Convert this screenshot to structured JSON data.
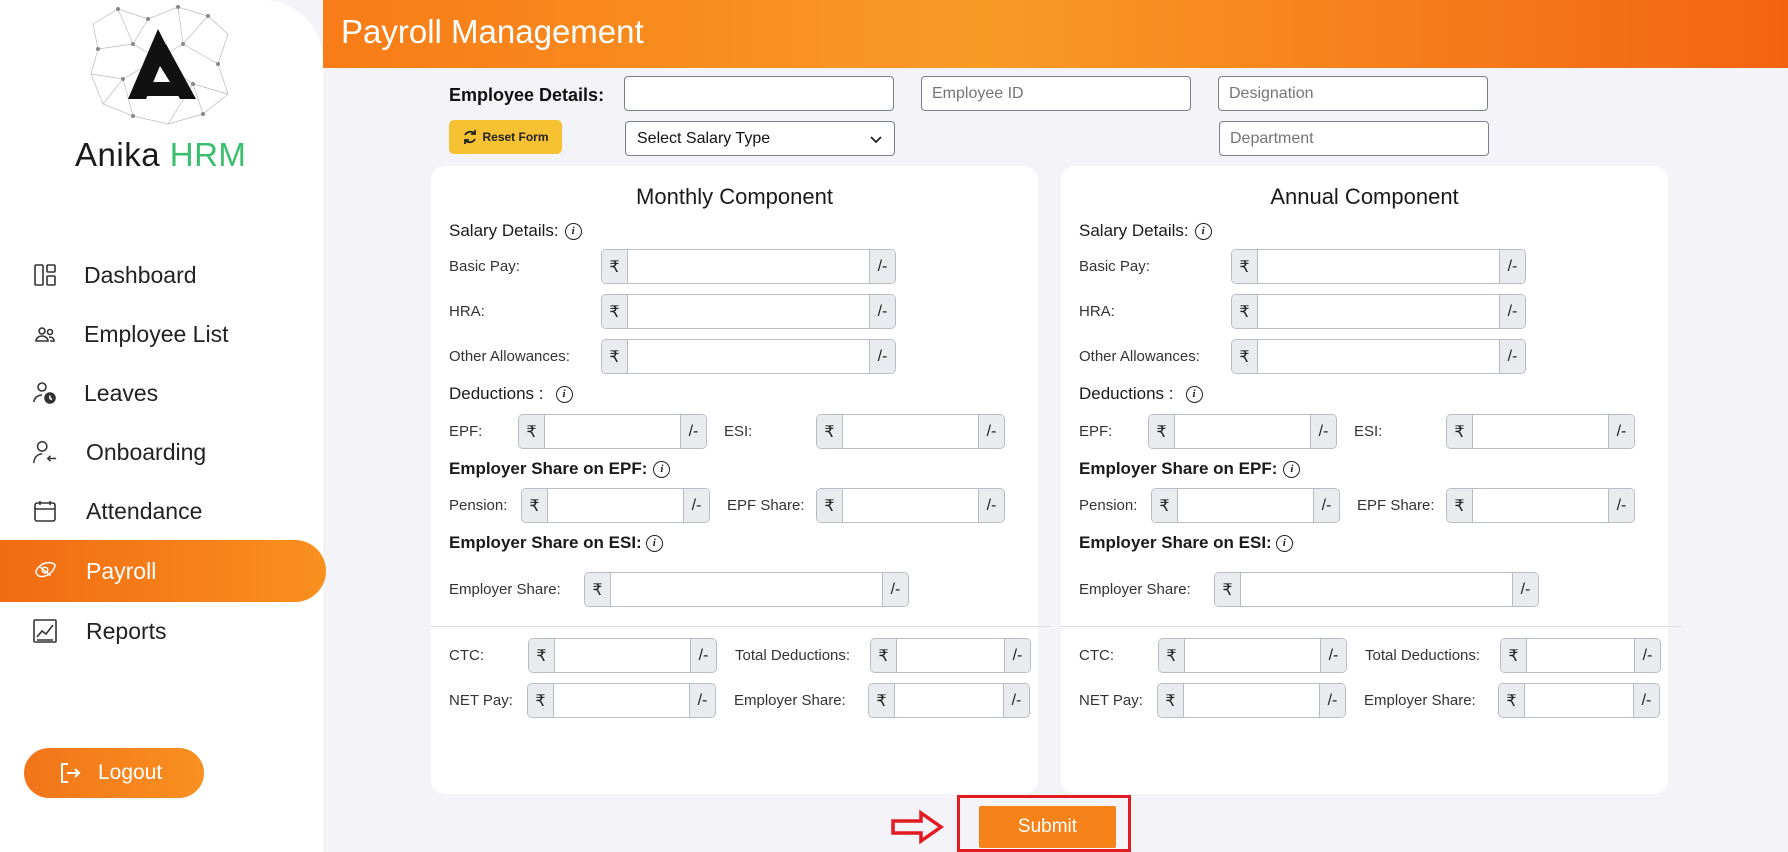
{
  "brand": {
    "name_main": "Anika",
    "name_accent": "HRM"
  },
  "sidebar": {
    "items": [
      {
        "label": "Dashboard",
        "icon": "dashboard-icon"
      },
      {
        "label": "Employee List",
        "icon": "users-icon"
      },
      {
        "label": "Leaves",
        "icon": "user-clock-icon"
      },
      {
        "label": "Onboarding",
        "icon": "user-arrow-icon"
      },
      {
        "label": "Attendance",
        "icon": "calendar-icon"
      },
      {
        "label": "Payroll",
        "icon": "money-icon",
        "active": true
      },
      {
        "label": "Reports",
        "icon": "chart-icon"
      }
    ],
    "logout_label": "Logout"
  },
  "header": {
    "title": "Payroll Management"
  },
  "employee": {
    "label": "Employee Details:",
    "name_value": "",
    "id_placeholder": "Employee ID",
    "designation_placeholder": "Designation",
    "department_placeholder": "Department",
    "salary_type": "Select Salary Type",
    "reset_label": "Reset Form"
  },
  "currency_prefix": "₹",
  "currency_suffix": "/-",
  "info_glyph": "i",
  "monthly": {
    "title": "Monthly Component",
    "salary_details": "Salary Details:",
    "basic_pay": "Basic Pay:",
    "hra": "HRA:",
    "other_allowances": "Other Allowances:",
    "deductions": "Deductions :",
    "epf": "EPF:",
    "esi": "ESI:",
    "employer_epf": "Employer Share on EPF:",
    "pension": "Pension:",
    "epf_share": "EPF Share:",
    "employer_esi": "Employer Share on ESI:",
    "employer_share": "Employer Share:",
    "ctc": "CTC:",
    "total_deductions": "Total Deductions:",
    "net_pay": "NET Pay:",
    "employer_share_total": "Employer Share:"
  },
  "annual": {
    "title": "Annual Component",
    "salary_details": "Salary Details:",
    "basic_pay": "Basic Pay:",
    "hra": "HRA:",
    "other_allowances": "Other Allowances:",
    "deductions": "Deductions :",
    "epf": "EPF:",
    "esi": "ESI:",
    "employer_epf": "Employer Share on EPF:",
    "pension": "Pension:",
    "epf_share": "EPF Share:",
    "employer_esi": "Employer Share on ESI:",
    "employer_share": "Employer Share:",
    "ctc": "CTC:",
    "total_deductions": "Total Deductions:",
    "net_pay": "NET Pay:",
    "employer_share_total": "Employer Share:"
  },
  "submit_label": "Submit",
  "colors": {
    "accent": "#f6821a",
    "brand_green": "#3bbf6e",
    "highlight": "#e21b23",
    "reset": "#f6c233"
  }
}
